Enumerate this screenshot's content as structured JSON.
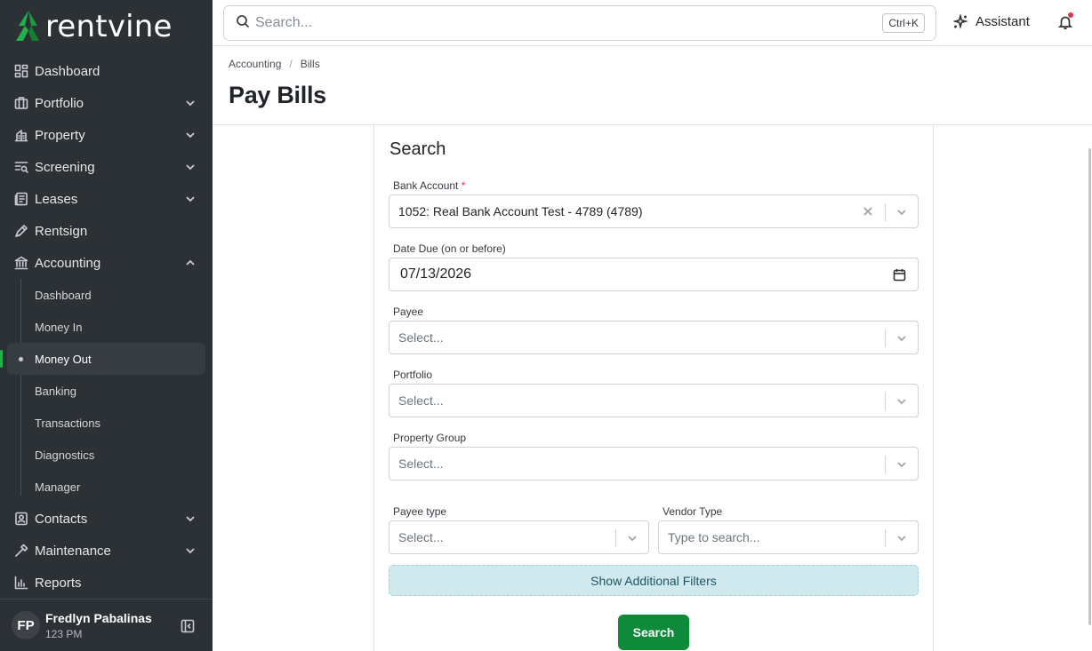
{
  "brand": {
    "name": "rentvine",
    "accent": "#22b14c"
  },
  "sidebar": {
    "items": [
      {
        "label": "Dashboard",
        "icon": "dashboard-icon",
        "has_chevron": false
      },
      {
        "label": "Portfolio",
        "icon": "portfolio-icon",
        "has_chevron": true
      },
      {
        "label": "Property",
        "icon": "property-icon",
        "has_chevron": true
      },
      {
        "label": "Screening",
        "icon": "screening-icon",
        "has_chevron": true
      },
      {
        "label": "Leases",
        "icon": "leases-icon",
        "has_chevron": true
      },
      {
        "label": "Rentsign",
        "icon": "rentsign-icon",
        "has_chevron": false
      },
      {
        "label": "Accounting",
        "icon": "accounting-icon",
        "has_chevron": true,
        "expanded": true
      }
    ],
    "accounting_sub": [
      "Dashboard",
      "Money In",
      "Money Out",
      "Banking",
      "Transactions",
      "Diagnostics",
      "Manager"
    ],
    "active_sub": "Money Out",
    "items_after": [
      {
        "label": "Contacts",
        "icon": "contacts-icon",
        "has_chevron": true
      },
      {
        "label": "Maintenance",
        "icon": "maintenance-icon",
        "has_chevron": true
      },
      {
        "label": "Reports",
        "icon": "reports-icon",
        "has_chevron": false
      }
    ],
    "user": {
      "initials": "FP",
      "name": "Fredlyn Pabalinas",
      "time": "123 PM"
    }
  },
  "topbar": {
    "search_placeholder": "Search...",
    "shortcut": "Ctrl+K",
    "assistant_label": "Assistant"
  },
  "header": {
    "breadcrumb": [
      "Accounting",
      "Bills"
    ],
    "title": "Pay Bills"
  },
  "form": {
    "title": "Search",
    "bank_account": {
      "label": "Bank Account",
      "required_mark": "*",
      "value": "1052: Real Bank Account Test - 4789 (4789)"
    },
    "date_due": {
      "label": "Date Due (on or before)",
      "value": "07/13/2026"
    },
    "payee": {
      "label": "Payee",
      "placeholder": "Select..."
    },
    "portfolio": {
      "label": "Portfolio",
      "placeholder": "Select..."
    },
    "property_group": {
      "label": "Property Group",
      "placeholder": "Select..."
    },
    "payee_type": {
      "label": "Payee type",
      "placeholder": "Select..."
    },
    "vendor_type": {
      "label": "Vendor Type",
      "placeholder": "Type to search..."
    },
    "filters_label": "Show Additional Filters",
    "search_label": "Search"
  }
}
